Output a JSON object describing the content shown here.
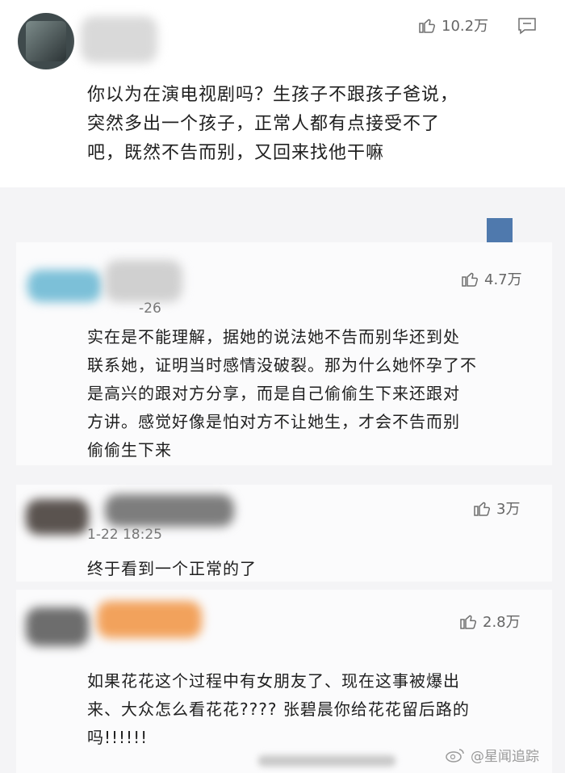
{
  "comments": [
    {
      "likes": "10.2万",
      "text_lines": [
        "你以为在演电视剧吗？生孩子不跟孩子爸说，",
        "突然多出一个孩子，正常人都有点接受不了",
        "吧，既然不告而别，又回来找他干嘛"
      ]
    },
    {
      "likes": "4.7万",
      "time": "-26",
      "text_lines": [
        "实在是不能理解，据她的说法她不告而别华还到处",
        "联系她，证明当时感情没破裂。那为什么她怀孕了不",
        "是高兴的跟对方分享，而是自己偷偷生下来还跟对",
        "方讲。感觉好像是怕对方不让她生，才会不告而别",
        "偷偷生下来"
      ]
    },
    {
      "likes": "3万",
      "time": "1-22 18:25",
      "text_lines": [
        "终于看到一个正常的了"
      ]
    },
    {
      "likes": "2.8万",
      "text_lines": [
        "如果花花这个过程中有女朋友了、现在这事被爆出",
        "来、大众怎么看花花???? 张碧晨你给花花留后路的",
        "吗!!!!!!"
      ]
    }
  ],
  "watermark": {
    "text": "@星闻追踪"
  },
  "icons": {
    "like": "thumbs-up-icon",
    "reply": "comment-icon",
    "weibo": "weibo-logo-icon"
  },
  "colors": {
    "accent_square": "#4f79ad"
  }
}
